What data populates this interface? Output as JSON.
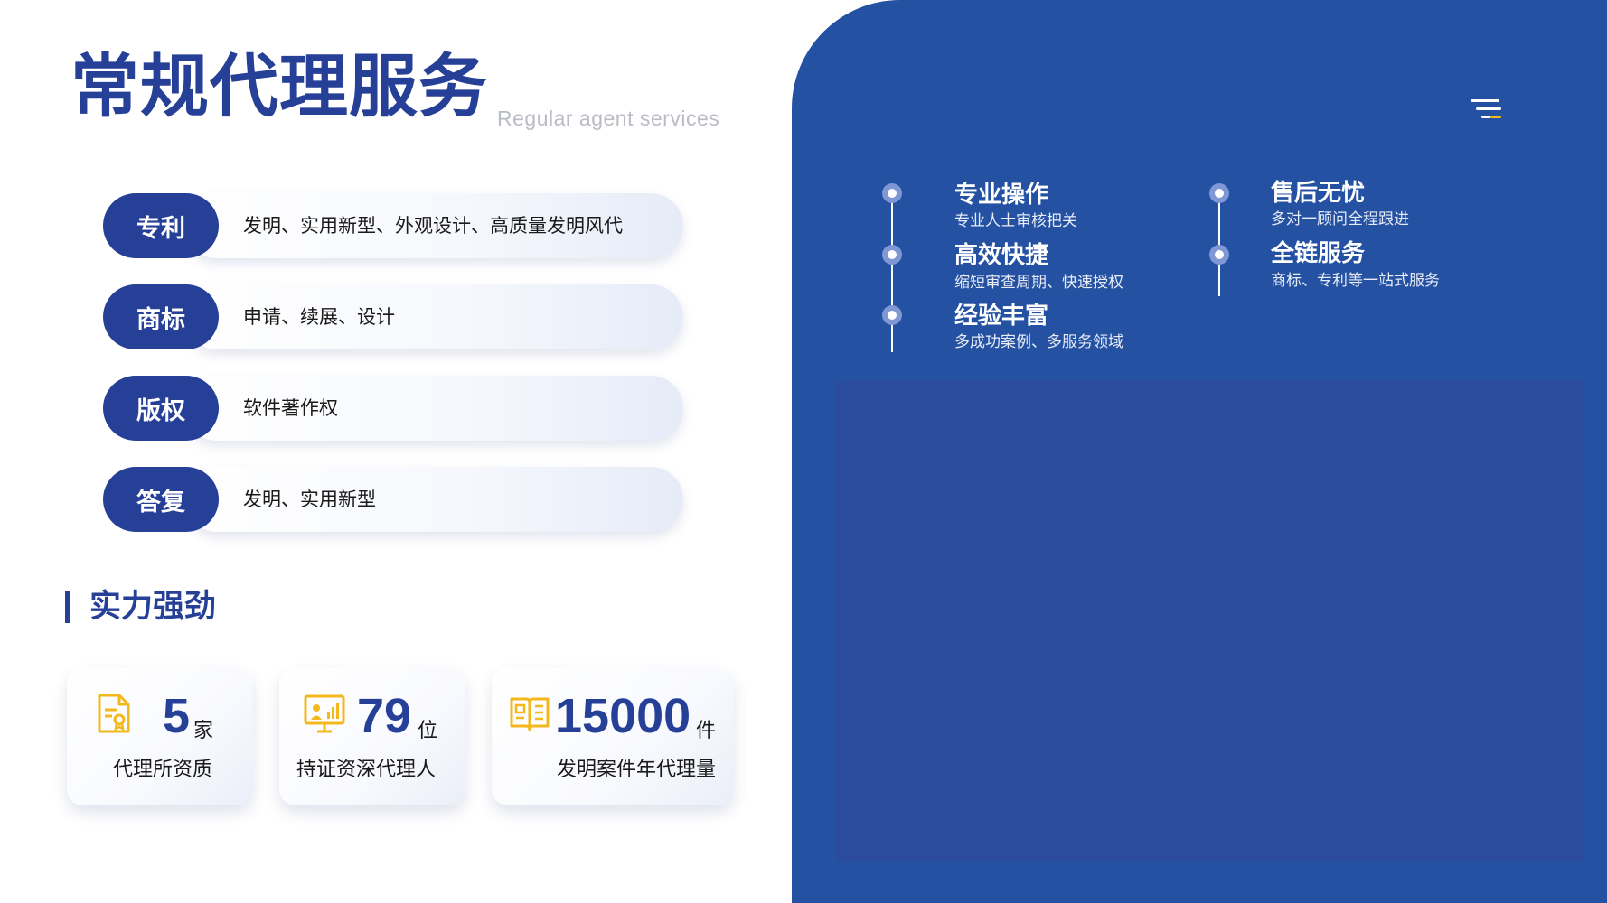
{
  "header": {
    "title": "常规代理服务",
    "subtitle": "Regular agent services"
  },
  "services": [
    {
      "tag": "专利",
      "desc": "发明、实用新型、外观设计、高质量发明风代"
    },
    {
      "tag": "商标",
      "desc": "申请、续展、设计"
    },
    {
      "tag": "版权",
      "desc": "软件著作权"
    },
    {
      "tag": "答复",
      "desc": "发明、实用新型"
    }
  ],
  "strength": {
    "title": "实力强劲",
    "stats": [
      {
        "icon": "certificate-icon",
        "value": "5",
        "unit": "家",
        "label": "代理所资质"
      },
      {
        "icon": "presenter-icon",
        "value": "79",
        "unit": "位",
        "label": "持证资深代理人"
      },
      {
        "icon": "book-icon",
        "value": "15000",
        "unit": "件",
        "label": "发明案件年代理量"
      }
    ]
  },
  "features": {
    "left": [
      {
        "title": "专业操作",
        "desc": "专业人士审核把关"
      },
      {
        "title": "高效快捷",
        "desc": "缩短审查周期、快速授权"
      },
      {
        "title": "经验丰富",
        "desc": "多成功案例、多服务领域"
      }
    ],
    "right": [
      {
        "title": "售后无忧",
        "desc": "多对一顾问全程跟进"
      },
      {
        "title": "全链服务",
        "desc": "商标、专利等一站式服务"
      }
    ]
  },
  "colors": {
    "brand_blue": "#263f97",
    "panel_blue": "#2451a2",
    "accent_yellow": "#f3b81c"
  }
}
